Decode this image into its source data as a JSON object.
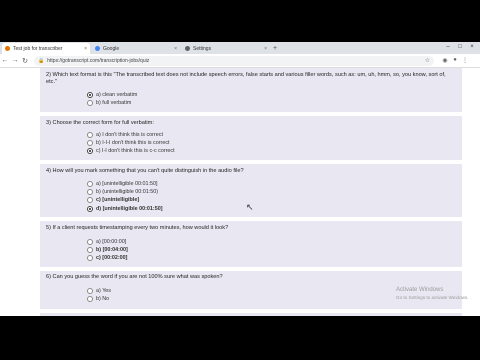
{
  "browser": {
    "tabs": [
      {
        "label": "Test job for transcriber",
        "color": "#e37400",
        "active": true
      },
      {
        "label": "Google",
        "color": "#4285f4",
        "active": false
      },
      {
        "label": "Settings",
        "color": "#5f6368",
        "active": false
      }
    ],
    "new_tab_icon": "plus-icon",
    "url": "https://gotranscript.com/transcription-jobs/quiz",
    "window_controls": [
      "minimize-icon",
      "maximize-icon",
      "close-icon"
    ]
  },
  "quiz": {
    "q2": {
      "text": "2) Which text format is this \"The transcribed text does not include speech errors, false starts and various filler words, such as: um, uh, hmm, so, you know, sort of, etc.\"",
      "options": [
        {
          "label": "a) clean verbatim",
          "selected": true
        },
        {
          "label": "b) full verbatim",
          "selected": false
        }
      ]
    },
    "q3": {
      "text": "3) Choose the correct form for full verbatim:",
      "options": [
        {
          "label": "a) I don't think this is correct",
          "selected": false
        },
        {
          "label": "b) I-I-I don't think this is correct",
          "selected": false
        },
        {
          "label": "c) I-I don't think this is c-c correct",
          "selected": true
        }
      ]
    },
    "q4": {
      "text": "4) How will you mark something that you can't quite distinguish in the audio file?",
      "options": [
        {
          "label": "a) [unintelligible 00:01:50]",
          "selected": false
        },
        {
          "label": "b) (unintelligible 00:01:50)",
          "selected": false
        },
        {
          "label": "c) [unintelligible]",
          "selected": false
        },
        {
          "label": "d) [unintelligible 00:01:50]",
          "selected": true
        }
      ]
    },
    "q5": {
      "text": "5) If a client requests timestamping every two minutes, how would it look?",
      "options": [
        {
          "label": "a) [00:00:00]",
          "selected": false
        },
        {
          "label": "b) [00:04:00]",
          "selected": false
        },
        {
          "label": "c) [00:02:00]",
          "selected": false
        }
      ]
    },
    "q6": {
      "text": "6) Can you guess the word if you are not 100% sure what was spoken?",
      "options": [
        {
          "label": "a) Yes",
          "selected": false
        },
        {
          "label": "b) No",
          "selected": false
        }
      ]
    }
  },
  "watermark": {
    "line1": "Activate Windows",
    "line2": "Go to Settings to activate Windows."
  }
}
